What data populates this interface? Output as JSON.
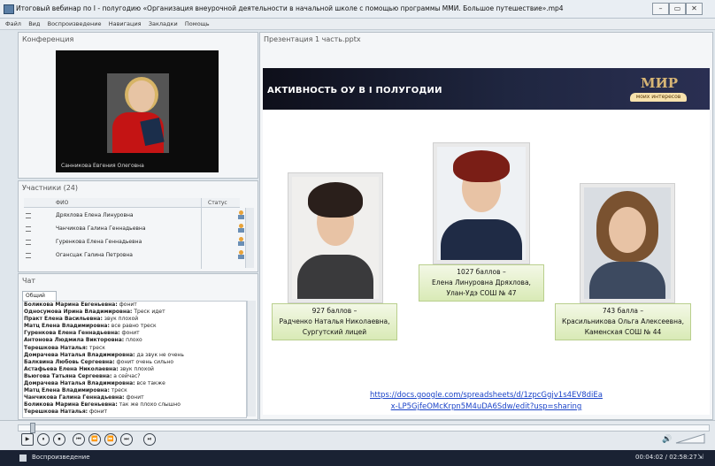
{
  "window": {
    "title": "Итоговый вебинар по I - полугодию «Организация внеурочной деятельности в начальной школе с помощью программы ММИ. Большое путешествие».mp4",
    "controls": [
      "–",
      "▭",
      "✕"
    ]
  },
  "menu": [
    "Файл",
    "Вид",
    "Воспроизведение",
    "Навигация",
    "Закладки",
    "Помощь"
  ],
  "conference": {
    "title": "Конференция",
    "video_caption": "Санникова Евгения Олеговна"
  },
  "participants": {
    "title": "Участники (24)",
    "col_name": "ФИО",
    "col_status": "Статус",
    "rows": [
      "Дряхлова Елена Линуровна",
      "Чанчикова Галина Геннадьевна",
      "Гуренкова Елена Геннадьевна",
      "Огансцак Галина Петровна"
    ]
  },
  "chat": {
    "title": "Чат",
    "tab": "Общий",
    "messages": [
      {
        "who": "Боликова  Марина Евгеньевна:",
        "text": " фонит"
      },
      {
        "who": "Односумова Ирина Владимировна:",
        "text": " Треск идет"
      },
      {
        "who": "Практ Елена Васильевна:",
        "text": " звук плохой"
      },
      {
        "who": "Матц Елена Владимировна:",
        "text": " все равно треск"
      },
      {
        "who": "Гуренкова Елена Геннадьевна:",
        "text": " фонит"
      },
      {
        "who": "Антонова Людмила Викторовна:",
        "text": " плохо"
      },
      {
        "who": "Терешкова Наталья:",
        "text": " треск"
      },
      {
        "who": "Домрачева Наталья Владимировна:",
        "text": " да звук не очень"
      },
      {
        "who": "Балквина Любовь Сергеевна:",
        "text": " фонит очень сильно"
      },
      {
        "who": "Астафьева Елена Николаевна:",
        "text": " звук плохой"
      },
      {
        "who": "Вьюгова Татьяна Сергеевна:",
        "text": " а сейчас?"
      },
      {
        "who": "Домрачева Наталья Владимировна:",
        "text": " все также"
      },
      {
        "who": "Матц Елена Владимировна:",
        "text": " треск"
      },
      {
        "who": "Чанчикова Галина Геннадьевна:",
        "text": " фонит"
      },
      {
        "who": "Боликова  Марина Евгеньевна:",
        "text": " так же плохо слышно"
      },
      {
        "who": "Терешкова Наталья:",
        "text": " фонит"
      }
    ]
  },
  "presentation": {
    "title": "Презентация 1 часть.pptx",
    "slide_heading": "АКТИВНОСТЬ ОУ В I ПОЛУГОДИИ",
    "logo_main": "МИР",
    "logo_sub": "моих интересов",
    "people": [
      {
        "score": "927 баллов –",
        "name": "Радченко Наталья Николаевна,",
        "org": "Сургутский лицей"
      },
      {
        "score": "1027 баллов –",
        "name": "Елена Линуровна Дряхлова,",
        "org": "Улан-Удэ СОШ № 47"
      },
      {
        "score": "743 балла –",
        "name": "Красильникова Ольга Алексеевна,",
        "org": "Каменская СОШ № 44"
      }
    ],
    "link_line1": "https://docs.google.com/spreadsheets/d/1zpcGgjv1s4EV8diEa",
    "link_line2": "x-LP5GjfeOMcKrpn5M4uDA6Sdw/edit?usp=sharing"
  },
  "player": {
    "seek_progress": 0.017,
    "buttons": [
      "▶",
      "⏸",
      "⏹",
      "⏮",
      "⏪",
      "⏩",
      "⏭",
      "⏯"
    ]
  },
  "status": {
    "mode": "Воспроизведение",
    "time": "00:04:02 / 02:58:27"
  }
}
